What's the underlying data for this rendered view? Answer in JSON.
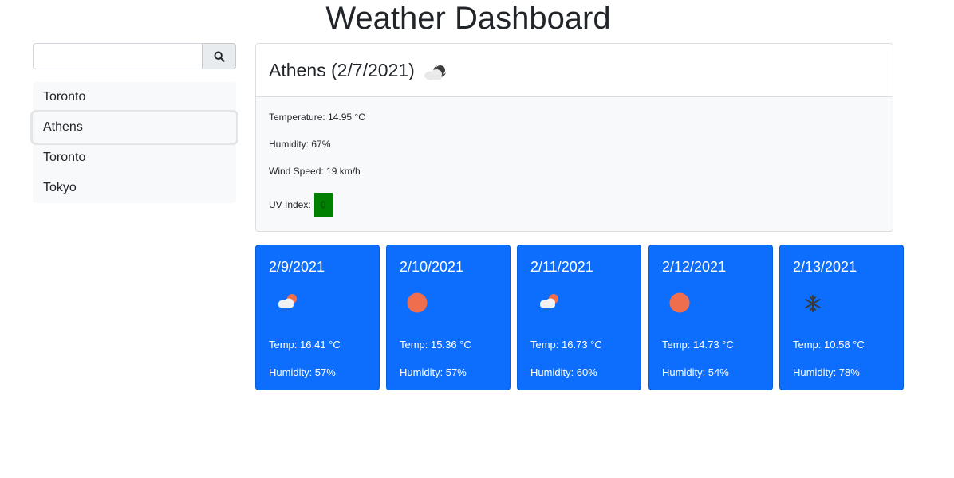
{
  "header": {
    "title": "Weather Dashboard"
  },
  "search": {
    "value": "",
    "placeholder": "",
    "button_icon": "search-icon"
  },
  "history": [
    {
      "label": "Toronto",
      "active": false
    },
    {
      "label": "Athens",
      "active": true
    },
    {
      "label": "Toronto",
      "active": false
    },
    {
      "label": "Tokyo",
      "active": false
    }
  ],
  "current": {
    "title": "Athens (2/7/2021)",
    "icon": "night-cloud-icon",
    "temperature": "Temperature: 14.95 °C",
    "humidity": "Humidity: 67%",
    "wind": "Wind Speed: 19 km/h",
    "uv_label": "UV Index:",
    "uv_value": "0",
    "uv_color": "#008000"
  },
  "forecast": [
    {
      "date": "2/9/2021",
      "icon": "rain-sun-cloud-icon",
      "temp": "Temp: 16.41 °C",
      "humidity": "Humidity: 57%"
    },
    {
      "date": "2/10/2021",
      "icon": "sun-icon",
      "temp": "Temp: 15.36 °C",
      "humidity": "Humidity: 57%"
    },
    {
      "date": "2/11/2021",
      "icon": "rain-sun-cloud-icon",
      "temp": "Temp: 16.73 °C",
      "humidity": "Humidity: 60%"
    },
    {
      "date": "2/12/2021",
      "icon": "sun-icon",
      "temp": "Temp: 14.73 °C",
      "humidity": "Humidity: 54%"
    },
    {
      "date": "2/13/2021",
      "icon": "snowflake-icon",
      "temp": "Temp: 10.58 °C",
      "humidity": "Humidity: 78%"
    }
  ],
  "colors": {
    "forecast_bg": "#0d6efd",
    "sun": "#ee6e4d",
    "uv_low": "#008000"
  }
}
